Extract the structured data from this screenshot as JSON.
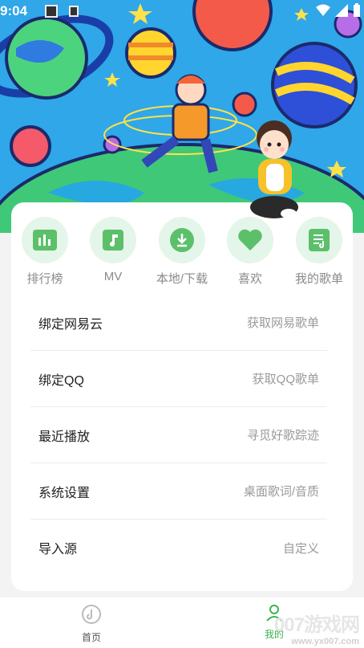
{
  "status_bar": {
    "time": "9:04"
  },
  "quick_actions": [
    {
      "label": "排行榜",
      "icon": "chart-bars-icon"
    },
    {
      "label": "MV",
      "icon": "music-note-icon"
    },
    {
      "label": "本地/下载",
      "icon": "download-icon"
    },
    {
      "label": "喜欢",
      "icon": "heart-icon"
    },
    {
      "label": "我的歌单",
      "icon": "playlist-icon"
    }
  ],
  "menu": [
    {
      "title": "绑定网易云",
      "hint": "获取网易歌单"
    },
    {
      "title": "绑定QQ",
      "hint": "获取QQ歌单"
    },
    {
      "title": "最近播放",
      "hint": "寻觅好歌踪迹"
    },
    {
      "title": "系统设置",
      "hint": "桌面歌词/音质"
    },
    {
      "title": "导入源",
      "hint": "自定义"
    }
  ],
  "bottom_nav": {
    "home_label": "首页",
    "mine_label": "我的"
  },
  "watermark": {
    "text": "007游戏网",
    "url": "www.yx007.com"
  },
  "colors": {
    "accent": "#39b54a",
    "icon_bg": "#e4f5e9",
    "icon_fg": "#5cc06a"
  }
}
